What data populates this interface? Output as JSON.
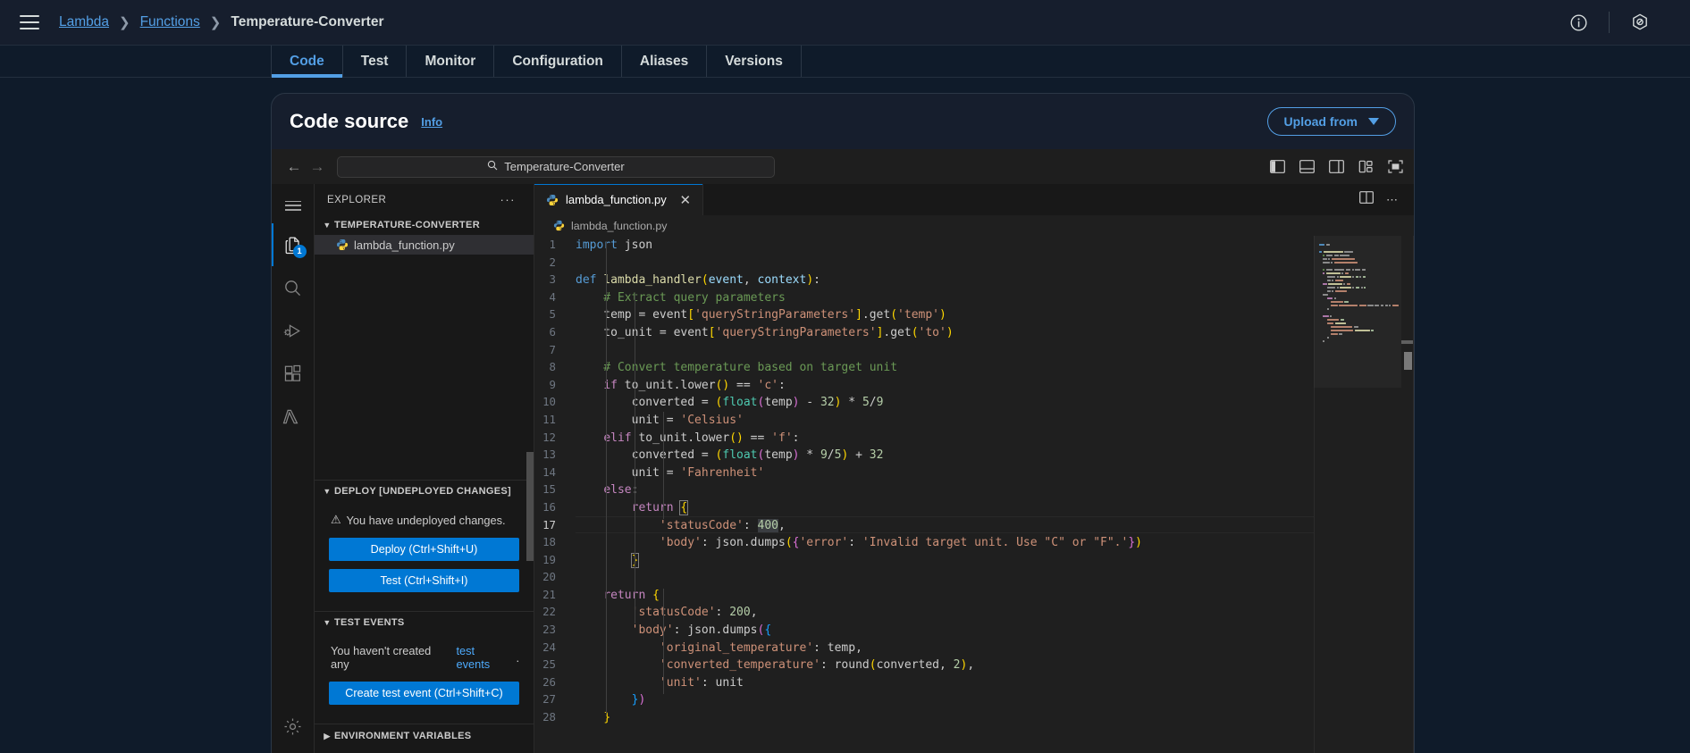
{
  "topbar": {
    "menu_icon": "hamburger-menu-icon",
    "breadcrumb": {
      "root": "Lambda",
      "section": "Functions",
      "current": "Temperature-Converter"
    },
    "info_icon": "info-circle-icon",
    "settings_icon": "settings-hexagon-icon"
  },
  "function_tabs": [
    {
      "label": "Code",
      "active": true
    },
    {
      "label": "Test",
      "active": false
    },
    {
      "label": "Monitor",
      "active": false
    },
    {
      "label": "Configuration",
      "active": false
    },
    {
      "label": "Aliases",
      "active": false
    },
    {
      "label": "Versions",
      "active": false
    }
  ],
  "panel": {
    "title": "Code source",
    "info_link": "Info",
    "upload_button": "Upload from"
  },
  "ide_toolbar": {
    "back_icon": "arrow-left-icon",
    "forward_icon": "arrow-right-icon",
    "quick_search_value": "Temperature-Converter",
    "search_icon": "search-icon",
    "layout_icons": [
      "toggle-primary-sidebar-icon",
      "toggle-panel-icon",
      "toggle-secondary-sidebar-icon",
      "customize-layout-icon",
      "fullscreen-icon"
    ]
  },
  "activity_bar": {
    "menu_icon": "activity-hamburger-icon",
    "items": [
      {
        "name": "explorer",
        "icon": "files-icon",
        "badge": "1",
        "active": true
      },
      {
        "name": "search",
        "icon": "search-icon",
        "badge": "",
        "active": false
      },
      {
        "name": "run-and-debug",
        "icon": "run-debug-icon",
        "badge": "",
        "active": false
      },
      {
        "name": "extensions",
        "icon": "extensions-icon",
        "badge": "",
        "active": false
      },
      {
        "name": "lambda",
        "icon": "lambda-icon",
        "badge": "",
        "active": false
      }
    ],
    "settings_icon": "gear-icon"
  },
  "explorer": {
    "title": "EXPLORER",
    "more_actions": "···",
    "folder": "TEMPERATURE-CONVERTER",
    "files": [
      {
        "name": "lambda_function.py",
        "icon": "python-file-icon",
        "selected": true
      }
    ],
    "deploy": {
      "title": "DEPLOY [UNDEPLOYED CHANGES]",
      "warning_icon": "warning-triangle-icon",
      "message": "You have undeployed changes.",
      "deploy_button": "Deploy (Ctrl+Shift+U)",
      "test_button": "Test (Ctrl+Shift+I)"
    },
    "test_events": {
      "title": "TEST EVENTS",
      "message_prefix": "You haven't created any ",
      "message_link": "test events",
      "message_suffix": ".",
      "create_button": "Create test event (Ctrl+Shift+C)"
    },
    "environment_variables": {
      "title": "ENVIRONMENT VARIABLES"
    }
  },
  "editor": {
    "tab": {
      "label": "lambda_function.py",
      "icon": "python-file-icon",
      "close_icon": "close-icon"
    },
    "tab_actions": [
      "split-editor-icon",
      "more-actions-icon"
    ],
    "breadcrumb": "lambda_function.py",
    "active_line": 17,
    "selection_text": "400",
    "total_lines": 28,
    "language": "python",
    "code_lines": [
      {
        "n": 1,
        "text": "import json"
      },
      {
        "n": 2,
        "text": ""
      },
      {
        "n": 3,
        "text": "def lambda_handler(event, context):"
      },
      {
        "n": 4,
        "text": "    # Extract query parameters"
      },
      {
        "n": 5,
        "text": "    temp = event['queryStringParameters'].get('temp')"
      },
      {
        "n": 6,
        "text": "    to_unit = event['queryStringParameters'].get('to')"
      },
      {
        "n": 7,
        "text": ""
      },
      {
        "n": 8,
        "text": "    # Convert temperature based on target unit"
      },
      {
        "n": 9,
        "text": "    if to_unit.lower() == 'c':"
      },
      {
        "n": 10,
        "text": "        converted = (float(temp) - 32) * 5/9"
      },
      {
        "n": 11,
        "text": "        unit = 'Celsius'"
      },
      {
        "n": 12,
        "text": "    elif to_unit.lower() == 'f':"
      },
      {
        "n": 13,
        "text": "        converted = (float(temp) * 9/5) + 32"
      },
      {
        "n": 14,
        "text": "        unit = 'Fahrenheit'"
      },
      {
        "n": 15,
        "text": "    else:"
      },
      {
        "n": 16,
        "text": "        return {"
      },
      {
        "n": 17,
        "text": "            'statusCode': 400,"
      },
      {
        "n": 18,
        "text": "            'body': json.dumps({'error': 'Invalid target unit. Use \"C\" or \"F\".'})"
      },
      {
        "n": 19,
        "text": "        }"
      },
      {
        "n": 20,
        "text": ""
      },
      {
        "n": 21,
        "text": "    return {"
      },
      {
        "n": 22,
        "text": "        'statusCode': 200,"
      },
      {
        "n": 23,
        "text": "        'body': json.dumps({"
      },
      {
        "n": 24,
        "text": "            'original_temperature': temp,"
      },
      {
        "n": 25,
        "text": "            'converted_temperature': round(converted, 2),"
      },
      {
        "n": 26,
        "text": "            'unit': unit"
      },
      {
        "n": 27,
        "text": "        })"
      },
      {
        "n": 28,
        "text": "    }"
      }
    ]
  },
  "colors": {
    "aws_bg": "#0f1b2a",
    "aws_panel": "#161e2d",
    "accent_blue": "#539fe5",
    "vscode_editor_bg": "#1f1f1f",
    "vscode_sidebar_bg": "#181818",
    "button_blue": "#0078d4"
  }
}
